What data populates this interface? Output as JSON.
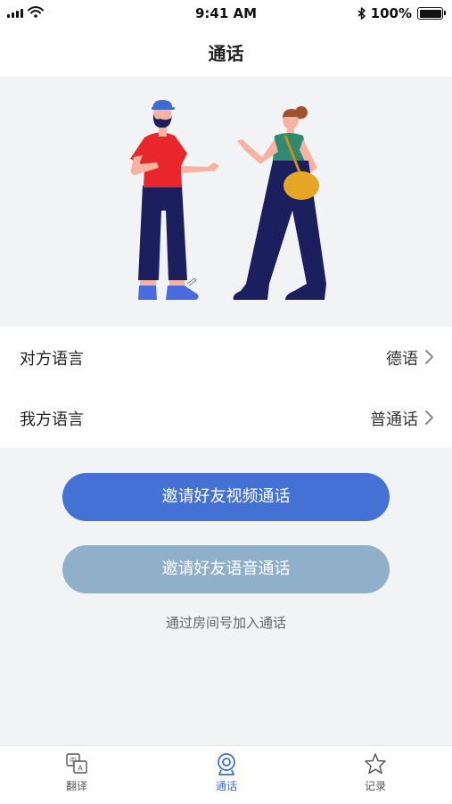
{
  "status_bar": {
    "time": "9:41 AM",
    "battery": "100%"
  },
  "nav": {
    "title": "通话"
  },
  "settings": [
    {
      "label": "对方语言",
      "value": "德语"
    },
    {
      "label": "我方语言",
      "value": "普通话"
    }
  ],
  "actions": {
    "video_call": "邀请好友视频通话",
    "voice_call": "邀请好友语音通话",
    "join_by_room": "通过房间号加入通话"
  },
  "tabs": [
    {
      "label": "翻译",
      "icon": "translate-icon",
      "active": false
    },
    {
      "label": "通话",
      "icon": "call-webcam-icon",
      "active": true
    },
    {
      "label": "记录",
      "icon": "star-icon",
      "active": false
    }
  ],
  "colors": {
    "primary": "#4472d4",
    "secondary": "#8fb0c8",
    "active_tab": "#3d6fd6"
  }
}
